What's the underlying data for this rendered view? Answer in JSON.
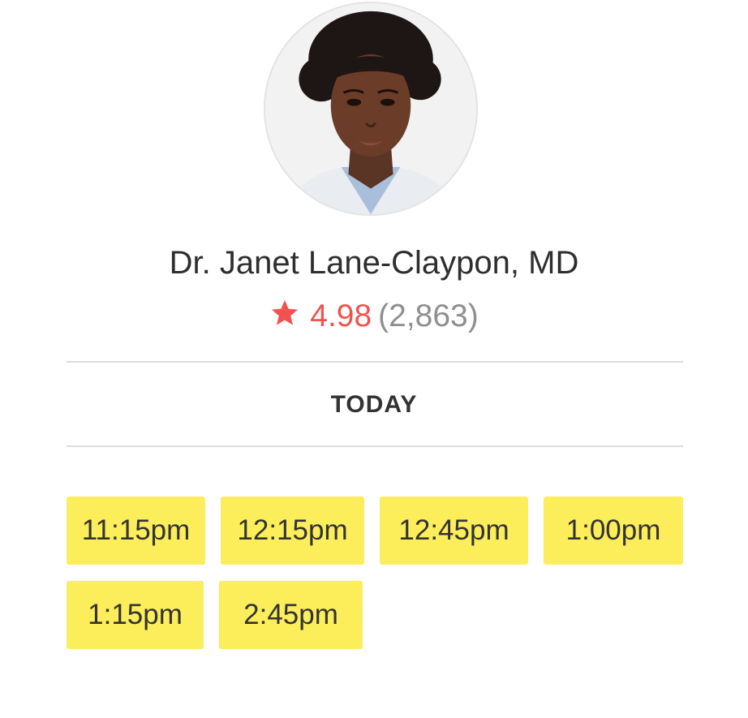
{
  "doctor": {
    "name": "Dr. Janet Lane-Claypon, MD",
    "avatar_icon": "doctor-portrait"
  },
  "rating": {
    "icon": "star-icon",
    "value": "4.98",
    "count": "(2,863)",
    "accent_color": "#f0534f"
  },
  "schedule": {
    "day_label": "TODAY",
    "slot_color": "#fcee5a",
    "slots": [
      "11:15pm",
      "12:15pm",
      "12:45pm",
      "1:00pm",
      "1:15pm",
      "2:45pm"
    ]
  }
}
